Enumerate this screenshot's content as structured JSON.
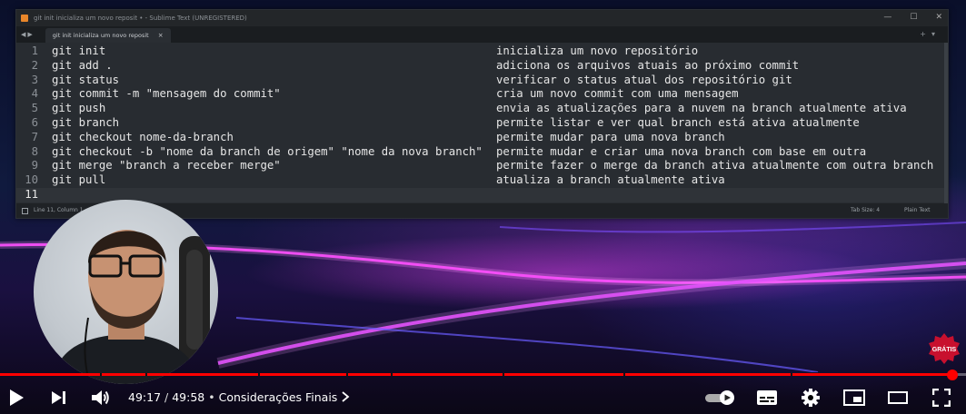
{
  "window": {
    "title": "git init inicializa um novo reposit • - Sublime Text (UNREGISTERED)",
    "tab_label": "git init inicializa um novo reposit",
    "tab_close": "×",
    "controls": [
      "—",
      "☐",
      "✕"
    ]
  },
  "editor": {
    "lines": [
      {
        "num": "1",
        "code": "git init",
        "desc": "inicializa um novo repositório"
      },
      {
        "num": "2",
        "code": "git add .",
        "desc": "adiciona os arquivos atuais ao próximo commit"
      },
      {
        "num": "3",
        "code": "git status",
        "desc": "verificar o status atual dos repositório git"
      },
      {
        "num": "4",
        "code": "git commit -m \"mensagem do commit\"",
        "desc": "cria um novo commit com uma mensagem"
      },
      {
        "num": "5",
        "code": "git push",
        "desc": "envia as atualizações para a nuvem na branch atualmente ativa"
      },
      {
        "num": "6",
        "code": "git branch",
        "desc": "permite listar e ver qual branch está ativa atualmente"
      },
      {
        "num": "7",
        "code": "git checkout nome-da-branch",
        "desc": "permite mudar para uma nova branch"
      },
      {
        "num": "8",
        "code": "git checkout -b \"nome da branch de origem\" \"nome da nova branch\"",
        "desc": "permite mudar e criar uma nova branch com base em outra"
      },
      {
        "num": "9",
        "code": "git merge \"branch a receber merge\"",
        "desc": "permite fazer o merge da branch ativa atualmente com outra branch"
      },
      {
        "num": "10",
        "code": "git pull",
        "desc": "atualiza a branch atualmente ativa"
      },
      {
        "num": "11",
        "code": "",
        "desc": ""
      }
    ]
  },
  "status": {
    "position": "Line 11, Column 1",
    "tab_size": "Tab Size: 4",
    "syntax": "Plain Text"
  },
  "badge": {
    "text": "GRÁTIS",
    "color": "#c8102e"
  },
  "player": {
    "current_time": "49:17",
    "duration": "49:58",
    "time_separator": "/",
    "chapter_bullet": "•",
    "chapter": "Considerações Finais",
    "progress_fraction": 0.986,
    "accent_color": "#ff0000",
    "icons": [
      "play-icon",
      "next-icon",
      "volume-icon",
      "autoplay-toggle-icon",
      "subtitles-icon",
      "settings-icon",
      "miniplayer-icon",
      "theater-mode-icon",
      "fullscreen-icon"
    ]
  }
}
